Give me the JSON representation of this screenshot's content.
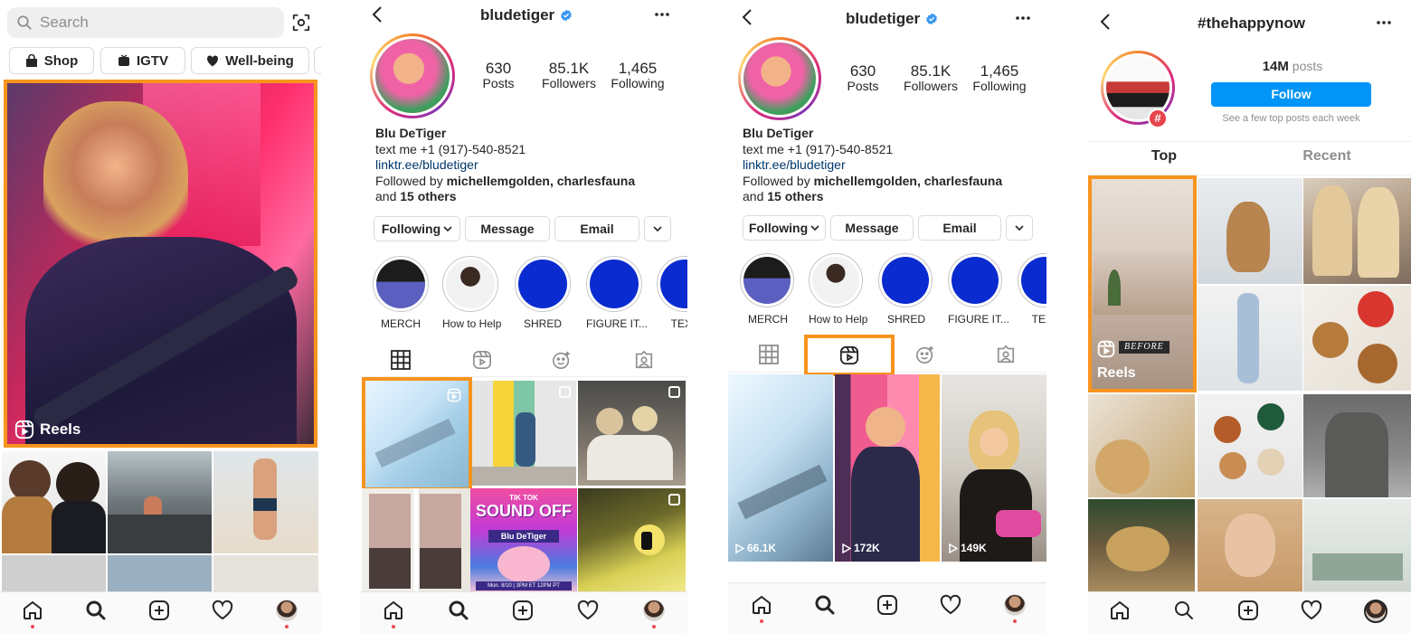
{
  "explore": {
    "search_placeholder": "Search",
    "chips": [
      {
        "label": "Shop"
      },
      {
        "label": "IGTV"
      },
      {
        "label": "Well-being"
      }
    ],
    "reels_label": "Reels"
  },
  "profile": {
    "username": "bludetiger",
    "stats": [
      {
        "value": "630",
        "label": "Posts"
      },
      {
        "value": "85.1K",
        "label": "Followers"
      },
      {
        "value": "1,465",
        "label": "Following"
      }
    ],
    "bio": {
      "name": "Blu DeTiger",
      "line1": "text me +1 (917)-540-8521",
      "link": "linktr.ee/bludetiger",
      "followed_prefix": "Followed by ",
      "followed_names": "michellemgolden, charlesfauna",
      "followed_and": "and ",
      "followed_others": "15 others"
    },
    "buttons": {
      "following": "Following",
      "message": "Message",
      "email": "Email"
    },
    "highlights": [
      {
        "label": "MERCH"
      },
      {
        "label": "How to Help"
      },
      {
        "label": "SHRED"
      },
      {
        "label": "FIGURE IT..."
      },
      {
        "label": "TEXT"
      }
    ],
    "reel_views": [
      "66.1K",
      "172K",
      "149K"
    ],
    "poster": {
      "title_top": "TIK TOK",
      "title_main": "SOUND OFF",
      "artist": "Blu DeTiger",
      "date": "Mon. 8/10 | 3PM ET 12PM PT"
    }
  },
  "hashtag": {
    "title": "#thehappynow",
    "posts_count": "14M",
    "posts_label": "posts",
    "follow_label": "Follow",
    "subtext": "See a few top posts each week",
    "tabs": [
      "Top",
      "Recent"
    ],
    "reels_label": "Reels",
    "before_label": "BEFORE"
  },
  "colors": {
    "highlight": "#f7941d",
    "follow_blue": "#0095f6",
    "verified": "#3897f0",
    "link": "#00376b",
    "notification": "#ed4956"
  }
}
